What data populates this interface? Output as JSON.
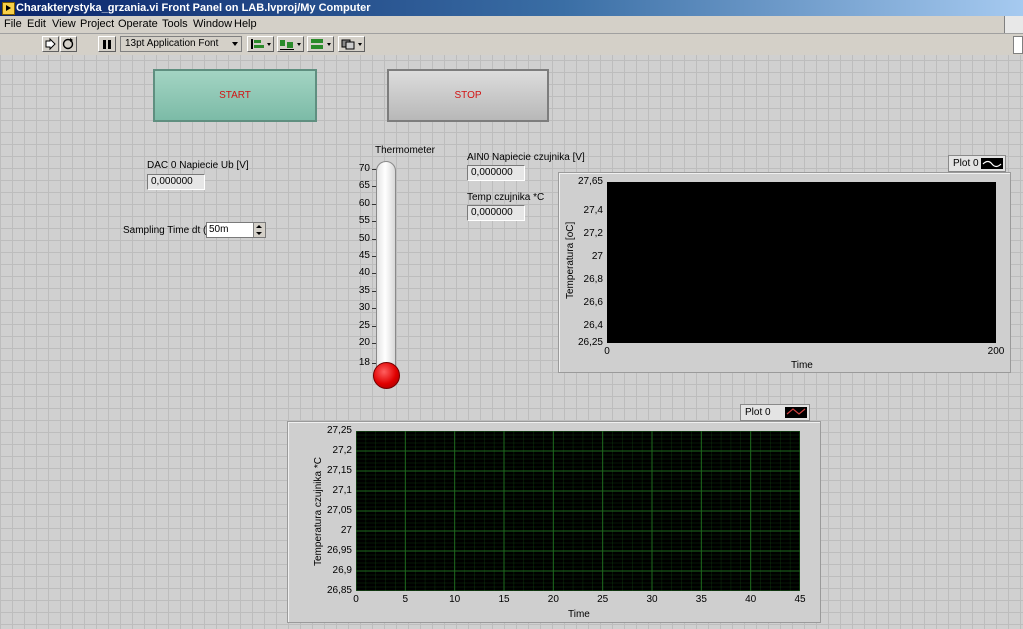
{
  "window": {
    "title": "Charakterystyka_grzania.vi Front Panel on LAB.lvproj/My Computer"
  },
  "menu": [
    "File",
    "Edit",
    "View",
    "Project",
    "Operate",
    "Tools",
    "Window",
    "Help"
  ],
  "toolbar": {
    "font_selector": "13pt Application Font"
  },
  "controls": {
    "start_label": "START",
    "stop_label": "STOP",
    "dac_label": "DAC 0 Napiecie Ub [V]",
    "dac_value": "0,000000",
    "sampling_label": "Sampling Time dt (s)",
    "sampling_value": "50m",
    "ain_label": "AIN0 Napiecie czujnika [V]",
    "ain_value": "0,000000",
    "temp_label": "Temp czujnika *C",
    "temp_value": "0,000000"
  },
  "thermometer": {
    "label": "Thermometer",
    "ticks": [
      "70",
      "65",
      "60",
      "55",
      "50",
      "45",
      "40",
      "35",
      "30",
      "25",
      "20",
      "18"
    ],
    "value": 18,
    "fill_color": "#e00000"
  },
  "chart_data": [
    {
      "type": "line",
      "legend": "Plot 0",
      "xlabel": "Time",
      "ylabel": "Temperatura [oC]",
      "x_ticks": [
        "0",
        "200"
      ],
      "y_ticks": [
        "27,65",
        "27,4",
        "27,2",
        "27",
        "26,8",
        "26,6",
        "26,4",
        "26,25"
      ],
      "xlim": [
        0,
        200
      ],
      "ylim": [
        26.25,
        27.65
      ],
      "grid": false,
      "series": [
        {
          "name": "Plot 0",
          "values": []
        }
      ]
    },
    {
      "type": "line",
      "legend": "Plot 0",
      "xlabel": "Time",
      "ylabel": "Temperatura czujnika *C",
      "x_ticks": [
        "0",
        "5",
        "10",
        "15",
        "20",
        "25",
        "30",
        "35",
        "40",
        "45"
      ],
      "y_ticks": [
        "27,25",
        "27,2",
        "27,15",
        "27,1",
        "27,05",
        "27",
        "26,95",
        "26,9",
        "26,85"
      ],
      "xlim": [
        0,
        45
      ],
      "ylim": [
        26.85,
        27.25
      ],
      "grid": true,
      "grid_color": "#1e6a1e",
      "series": [
        {
          "name": "Plot 0",
          "values": []
        }
      ]
    }
  ]
}
